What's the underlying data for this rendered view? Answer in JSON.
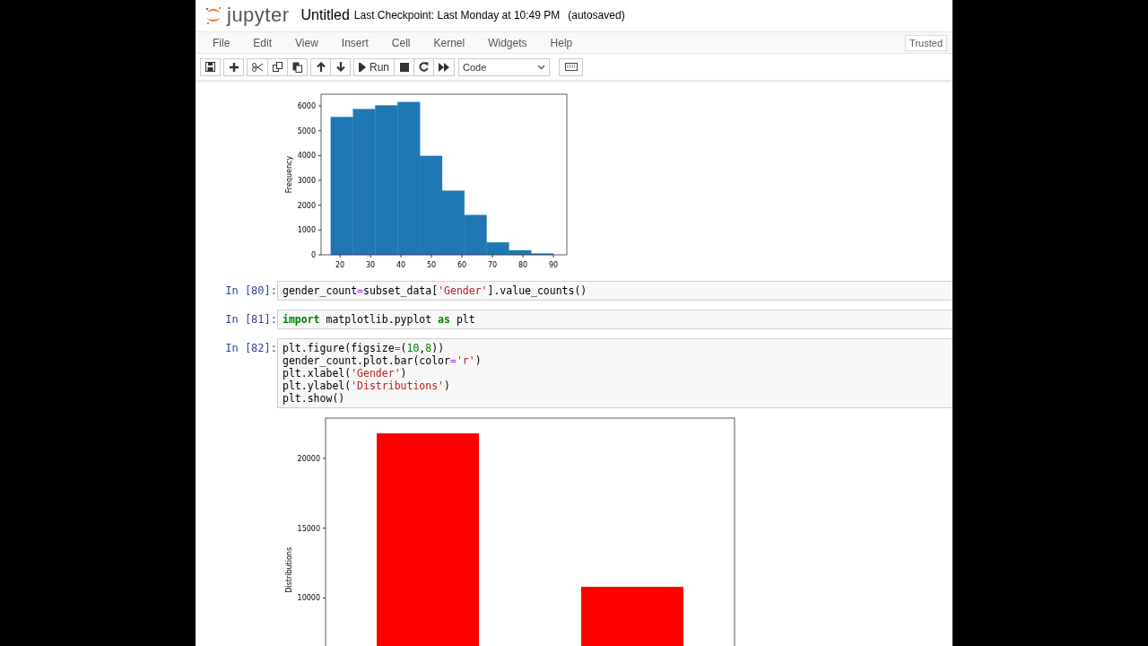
{
  "header": {
    "logo_text": "jupyter",
    "notebook_name": "Untitled",
    "checkpoint": "Last Checkpoint: Last Monday at 10:49 PM",
    "autosave": "(autosaved)"
  },
  "menu": [
    "File",
    "Edit",
    "View",
    "Insert",
    "Cell",
    "Kernel",
    "Widgets",
    "Help"
  ],
  "trusted": "Trusted",
  "toolbar": {
    "groups": [
      [
        {
          "kind": "save"
        }
      ],
      [
        {
          "kind": "plus"
        }
      ],
      [
        {
          "kind": "cut"
        },
        {
          "kind": "copy"
        },
        {
          "kind": "paste"
        }
      ],
      [
        {
          "kind": "up"
        },
        {
          "kind": "down"
        }
      ],
      [
        {
          "kind": "run",
          "label": "Run"
        },
        {
          "kind": "stop"
        },
        {
          "kind": "restart"
        },
        {
          "kind": "fastforward"
        }
      ]
    ],
    "cell_type": "Code"
  },
  "outputs_top": {
    "chart_data": {
      "type": "bar",
      "ylabel": "Frequency",
      "x": [
        20.65,
        27.95,
        35.25,
        42.55,
        49.85,
        57.15,
        64.45,
        71.75,
        79.05,
        86.35
      ],
      "values": [
        5550,
        5870,
        6020,
        6150,
        3980,
        2580,
        1600,
        500,
        180,
        50
      ],
      "xlim": [
        13.8,
        94.4
      ],
      "ylim": [
        0,
        6470
      ],
      "xticks": [
        20,
        30,
        40,
        50,
        60,
        70,
        80,
        90
      ],
      "yticks": [
        0,
        1000,
        2000,
        3000,
        4000,
        5000,
        6000
      ]
    }
  },
  "cells": [
    {
      "prompt": "In [80]:",
      "lines": [
        [
          {
            "kind": "plain",
            "t": "gender_count"
          },
          {
            "kind": "op",
            "t": "="
          },
          {
            "kind": "plain",
            "t": "subset_data["
          },
          {
            "kind": "string",
            "t": "'Gender'"
          },
          {
            "kind": "plain",
            "t": "].value_counts()"
          }
        ]
      ]
    },
    {
      "prompt": "In [81]:",
      "lines": [
        [
          {
            "kind": "keyword",
            "t": "import"
          },
          {
            "kind": "plain",
            "t": " matplotlib.pyplot "
          },
          {
            "kind": "keyword",
            "t": "as"
          },
          {
            "kind": "plain",
            "t": " plt"
          }
        ]
      ]
    },
    {
      "prompt": "In [82]:",
      "lines": [
        [
          {
            "kind": "plain",
            "t": "plt.figure(figsize"
          },
          {
            "kind": "op",
            "t": "="
          },
          {
            "kind": "plain",
            "t": "("
          },
          {
            "kind": "number",
            "t": "10"
          },
          {
            "kind": "plain",
            "t": ","
          },
          {
            "kind": "number",
            "t": "8"
          },
          {
            "kind": "plain",
            "t": "))"
          }
        ],
        [
          {
            "kind": "plain",
            "t": "gender_count.plot.bar(color"
          },
          {
            "kind": "op",
            "t": "="
          },
          {
            "kind": "string",
            "t": "'r'"
          },
          {
            "kind": "plain",
            "t": ")"
          }
        ],
        [
          {
            "kind": "plain",
            "t": "plt.xlabel("
          },
          {
            "kind": "string",
            "t": "'Gender'"
          },
          {
            "kind": "plain",
            "t": ")"
          }
        ],
        [
          {
            "kind": "plain",
            "t": "plt.ylabel("
          },
          {
            "kind": "string",
            "t": "'Distributions'"
          },
          {
            "kind": "plain",
            "t": ")"
          }
        ],
        [
          {
            "kind": "plain",
            "t": "plt.show()"
          }
        ]
      ]
    }
  ],
  "output_bottom": {
    "chart_data": {
      "type": "bar",
      "ylabel": "Distributions",
      "series": [
        {
          "color": "#ff0000",
          "values": [
            21800,
            10800
          ]
        }
      ],
      "ylim": [
        0,
        22890
      ],
      "yticks": [
        10000,
        15000,
        20000
      ]
    }
  }
}
